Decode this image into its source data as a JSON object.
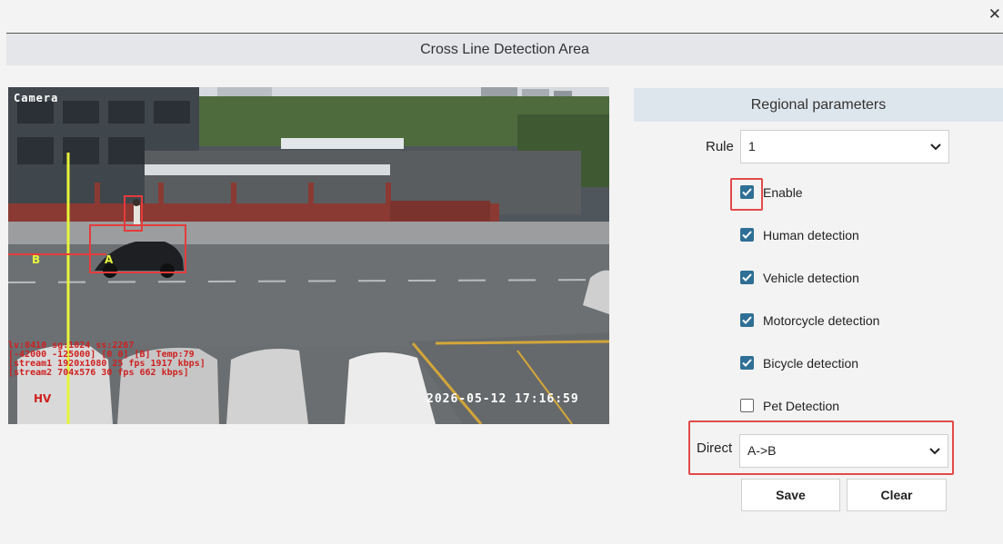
{
  "window": {
    "close_glyph": "✕",
    "title": "Cross Line Detection Area"
  },
  "camera": {
    "label": "Camera",
    "osd_lines": [
      "lv:8410 sg:1024 ss:2267",
      "[-42000 -125000] [0 0] [B] Temp:79",
      "[stream1 1920x1080 25 fps 1917 kbps]",
      "[stream2 704x576 30 fps 662 kbps]"
    ],
    "timestamp": "2026-05-12 17:16:59",
    "hv": "HV",
    "marker_a": "A",
    "marker_b": "B"
  },
  "panel": {
    "header": "Regional parameters",
    "rule_label": "Rule",
    "rule_value": "1",
    "enable_label": "Enable",
    "options": [
      {
        "label": "Human detection",
        "checked": true
      },
      {
        "label": "Vehicle detection",
        "checked": true
      },
      {
        "label": "Motorcycle detection",
        "checked": true
      },
      {
        "label": "Bicycle detection",
        "checked": true
      },
      {
        "label": "Pet Detection",
        "checked": false
      }
    ],
    "direct_label": "Direct",
    "direct_value": "A->B",
    "save_label": "Save",
    "clear_label": "Clear"
  },
  "colors": {
    "accent": "#2f6f95",
    "highlight": "#e24a4a",
    "line": "#e7f53a",
    "header_bg": "#dde5ed"
  }
}
